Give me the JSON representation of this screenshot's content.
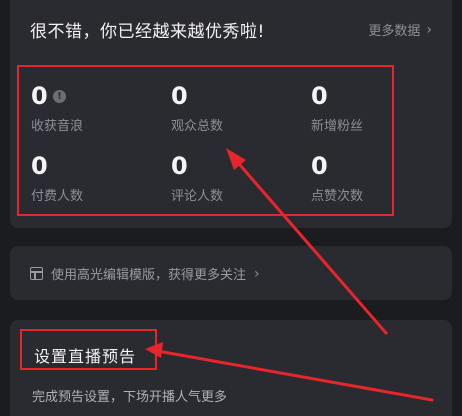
{
  "header": {
    "title": "很不错，你已经越来越优秀啦!",
    "more_label": "更多数据"
  },
  "stats": [
    {
      "value": "0",
      "label": "收获音浪"
    },
    {
      "value": "0",
      "label": "观众总数"
    },
    {
      "value": "0",
      "label": "新增粉丝"
    },
    {
      "value": "0",
      "label": "付费人数"
    },
    {
      "value": "0",
      "label": "评论人数"
    },
    {
      "value": "0",
      "label": "点赞次数"
    }
  ],
  "hint": {
    "text": "使用高光编辑模版，获得更多关注"
  },
  "live_preview": {
    "title": "设置直播预告",
    "description": "完成预告设置，下场开播人气更多"
  },
  "annotations": {
    "color": "#e8252b"
  },
  "icons": {
    "info": "info-icon",
    "more": "chevron-right-icon",
    "template": "template-layout-icon"
  }
}
